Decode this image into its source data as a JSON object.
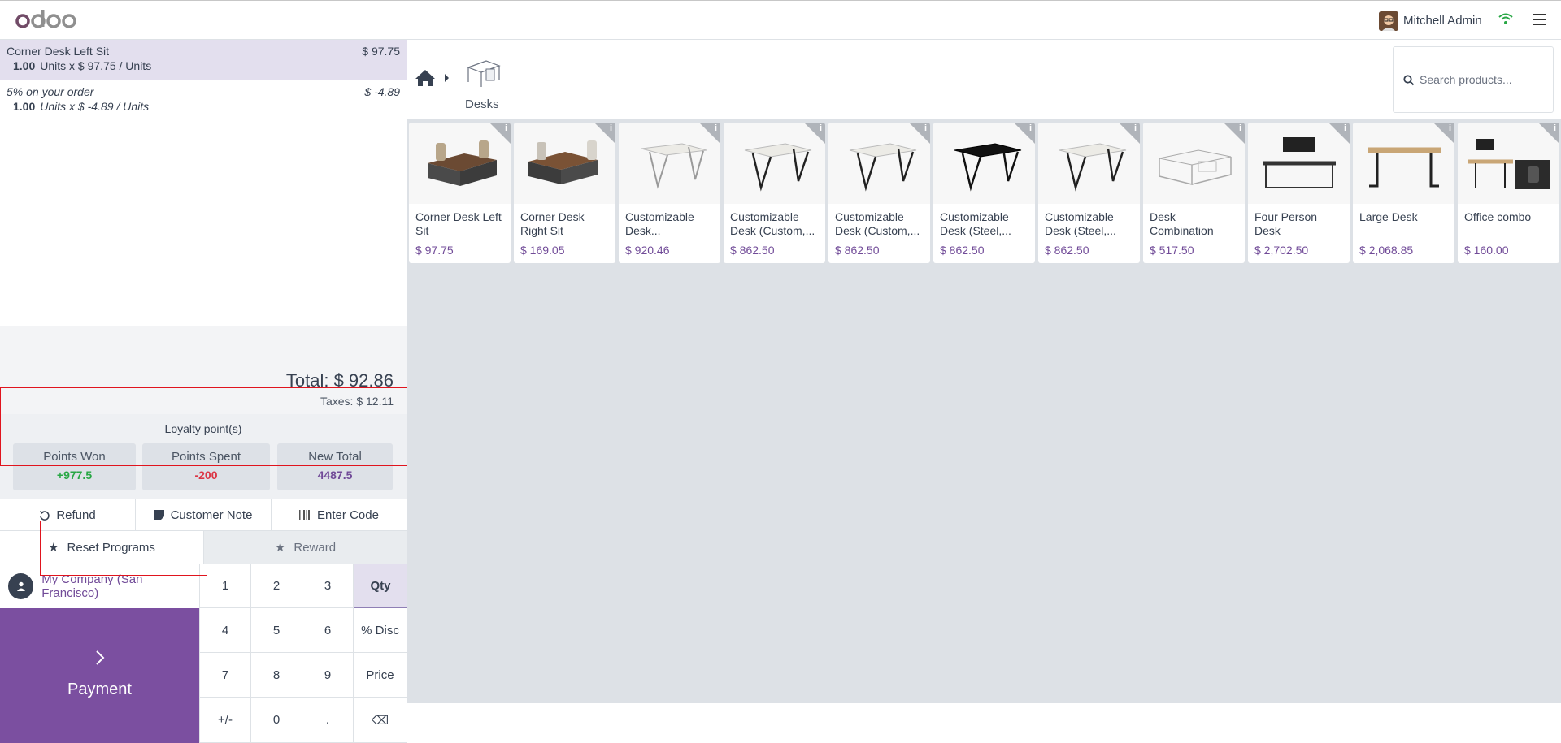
{
  "header": {
    "logo_text": "odoo",
    "user_name": "Mitchell Admin"
  },
  "order": {
    "lines": [
      {
        "name": "Corner Desk Left Sit",
        "price": "$ 97.75",
        "qty": "1.00",
        "detail": "Units x $ 97.75 / Units"
      },
      {
        "name": "5% on your order",
        "price": "$ -4.89",
        "qty": "1.00",
        "detail": "Units x $ -4.89 / Units"
      }
    ],
    "total_label": "Total: $ 92.86",
    "taxes_label": "Taxes: $ 12.11"
  },
  "loyalty": {
    "title": "Loyalty point(s)",
    "won_label": "Points Won",
    "won_value": "+977.5",
    "spent_label": "Points Spent",
    "spent_value": "-200",
    "total_label": "New Total",
    "total_value": "4487.5"
  },
  "controls": {
    "refund": "Refund",
    "customer_note": "Customer Note",
    "enter_code": "Enter Code",
    "reset_programs": "Reset Programs",
    "reward": "Reward"
  },
  "customer": {
    "name": "My Company (San Francisco)"
  },
  "payment": {
    "label": "Payment"
  },
  "numpad": {
    "keys": [
      "1",
      "2",
      "3",
      "Qty",
      "4",
      "5",
      "6",
      "% Disc",
      "7",
      "8",
      "9",
      "Price",
      "+/-",
      "0",
      ".",
      "⌫"
    ]
  },
  "category": {
    "label": "Desks"
  },
  "search": {
    "placeholder": "Search products..."
  },
  "products": [
    {
      "name": "Corner Desk Left Sit",
      "price": "$ 97.75"
    },
    {
      "name": "Corner Desk Right Sit",
      "price": "$ 169.05"
    },
    {
      "name": "Customizable Desk...",
      "price": "$ 920.46"
    },
    {
      "name": "Customizable Desk (Custom,...",
      "price": "$ 862.50"
    },
    {
      "name": "Customizable Desk (Custom,...",
      "price": "$ 862.50"
    },
    {
      "name": "Customizable Desk (Steel,...",
      "price": "$ 862.50"
    },
    {
      "name": "Customizable Desk (Steel,...",
      "price": "$ 862.50"
    },
    {
      "name": "Desk Combination",
      "price": "$ 517.50"
    },
    {
      "name": "Four Person Desk",
      "price": "$ 2,702.50"
    },
    {
      "name": "Large Desk",
      "price": "$ 2,068.85"
    },
    {
      "name": "Office combo",
      "price": "$ 160.00"
    }
  ],
  "colors": {
    "accent": "#714b98",
    "payment_bg": "#7b4fa0",
    "won": "#28a745",
    "spent": "#dc3545"
  }
}
